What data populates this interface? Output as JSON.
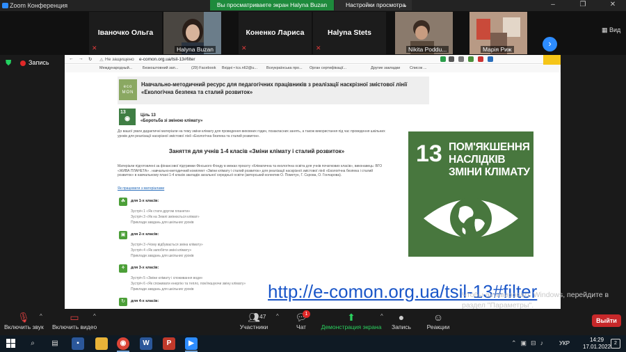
{
  "window": {
    "title": "Zoom Конференция"
  },
  "share": {
    "banner": "Вы просматриваете экран Halyna Buzan",
    "view_options": "Настройки просмотра"
  },
  "participants": [
    {
      "name": "Іваночко Ольга",
      "video": false
    },
    {
      "name": "Halyna Buzan",
      "video": true
    },
    {
      "name": "Коненко Лариса",
      "video": false
    },
    {
      "name": "Halyna Stets",
      "video": false
    },
    {
      "name": "Nikita Poddu...",
      "video": true
    },
    {
      "name": "Марія Риж",
      "video": true
    }
  ],
  "view_button": "Вид",
  "recording": {
    "label": "Запись"
  },
  "browser": {
    "security": "Не защищено",
    "url": "e-comon.org.ua/tsil-13#filter",
    "bookmarks": [
      "Международный...",
      "Безкоштовний зап...",
      "(29) Facebook",
      "Вхідні • tcs.n62@u...",
      "Всеукраїнська про...",
      "Орган сертифікації...",
      "Другие закладки",
      "Список ..."
    ]
  },
  "page": {
    "logo": "eco MON",
    "title": "Навчально-методичний ресурс для педагогічних працівників з реалізації наскрізної змістової лінії «Екологічна безпека та сталий розвиток»",
    "goal_small_num": "13",
    "goal_label_1": "Ціль 13",
    "goal_label_2": "«Боротьба зі зміною клімату»",
    "intro": "До вашої уваги дидактичні матеріали на тему зміни клімату для проведення виховних годин, позакласних занять, а також використання під час проведення шкільних уроків для реалізації наскрізної змістової лінії «Екологічна безпека та сталий розвиток».",
    "lesson_title": "Заняття для учнів 1-4 класів «Зміни клімату і сталий розвиток»",
    "lesson_desc": "Матеріали підготовлені за фінансової підтримки Фінського Фонду в межах проєкту «Кліматична та екологічна освіта для учнів початкових класів», виконавець: ВГО «ЖИВА ПЛАНЕТА» . навчально-методичний комплект «Зміни клімату і сталий розвиток» для реалізації наскрізної змістової лінії «Екологічна безпека і сталий розвиток» в навчальному плані 1-4 класів закладів загальної середньої освіти (авторський колектив О. Пометун, Г. Сєрова, О. Гончарова).",
    "lesson_link": "Як працювати з матеріалами",
    "grades": [
      {
        "title": "для 1-х класів:",
        "icon": "☘",
        "items": [
          "Зустріч 1 «Як стати другом планети»",
          "Зустріч 3 «Як на Землі змінюється клімат»",
          "Приклади завдань для шкільних уроків"
        ]
      },
      {
        "title": "для 2-х класів:",
        "icon": "▣",
        "items": [
          "Зустріч 3 «Чому відбувається зміна клімату»",
          "Зустріч 4 «Як запобігти зміні клімату»",
          "Приклади завдань для шкільних уроків"
        ]
      },
      {
        "title": "для 3-х класів:",
        "icon": "⚘",
        "items": [
          "Зустріч 5 «Зміни клімату і споживання води»",
          "Зустріч 6 «Як споживати енергію та тепло, пом'якшуючи зміну клімату»",
          "Приклади завдань для шкільних уроків"
        ]
      },
      {
        "title": "для 4-х класів:",
        "icon": "↻",
        "items": []
      }
    ]
  },
  "sdg": {
    "number": "13",
    "text": "ПОМ'ЯКШЕННЯ НАСЛІДКІВ ЗМІНИ КЛІМАТУ",
    "color": "#48773e"
  },
  "overlay_link": "http://e-comon.org.ua/tsil-13#filter",
  "windows_activation": "Чтобы активировать Windows, перейдите в раздел \"Параметры\".",
  "controls": {
    "audio": "Включить звук",
    "video": "Включить видео",
    "participants": "Участники",
    "participants_count": "47",
    "chat": "Чат",
    "chat_badge": "1",
    "share": "Демонстрация экрана",
    "record": "Запись",
    "reactions": "Реакции",
    "end": "Выйти"
  },
  "taskbar": {
    "lang": "УКР",
    "time": "14:29",
    "date": "17.01.2022",
    "notifications": "2"
  }
}
